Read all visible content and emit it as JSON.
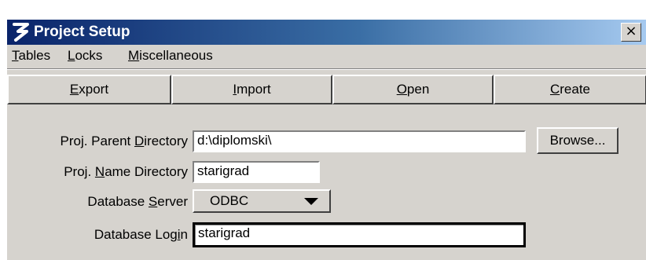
{
  "window": {
    "title": "Project Setup",
    "close_glyph": "×",
    "app_icon": "bentley-b-icon",
    "title_bar_color": "#0a246a"
  },
  "menu": {
    "items": [
      {
        "mnemonic": "T",
        "rest": "ables"
      },
      {
        "mnemonic": "L",
        "rest": "ocks"
      },
      {
        "mnemonic": "M",
        "rest": "iscellaneous"
      }
    ]
  },
  "toolbar": {
    "buttons": [
      {
        "mnemonic": "E",
        "rest": "xport"
      },
      {
        "mnemonic": "I",
        "rest": "mport"
      },
      {
        "mnemonic": "O",
        "rest": "pen"
      },
      {
        "mnemonic": "C",
        "rest": "reate"
      }
    ]
  },
  "form": {
    "parent_dir": {
      "pre": "Proj. Parent ",
      "mnemonic": "D",
      "post": "irectory",
      "value": "d:\\diplomski\\"
    },
    "name_dir": {
      "pre": "Proj. ",
      "mnemonic": "N",
      "post": "ame Directory",
      "value": "starigrad"
    },
    "db_server": {
      "pre": "Database ",
      "mnemonic": "S",
      "post": "erver",
      "value": "ODBC"
    },
    "db_login": {
      "pre": "Database Log",
      "mnemonic": "i",
      "post": "n",
      "value": "starigrad"
    },
    "browse_label": "Browse..."
  }
}
